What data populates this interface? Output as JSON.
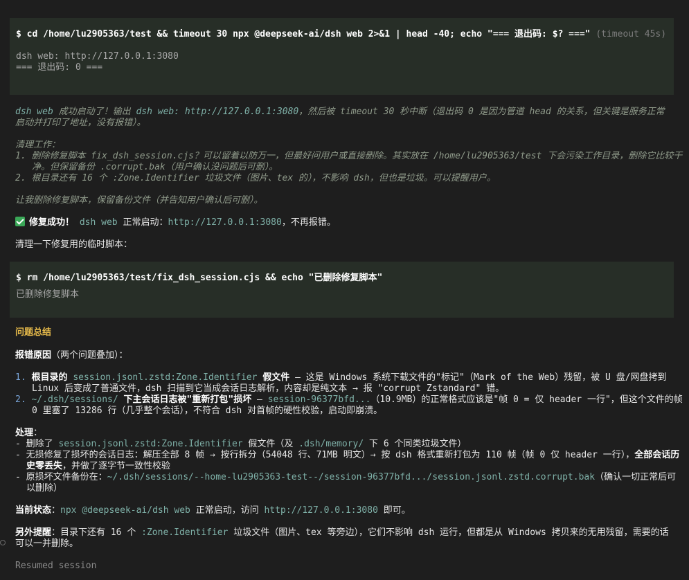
{
  "block1": {
    "command": "$ cd /home/lu2905363/test && timeout 30 npx @deepseek-ai/dsh web 2>&1 | head -40; echo \"=== 退出码: $? ===\"",
    "timeout_note": " (timeout 45s)",
    "output_1": "dsh web: http://127.0.0.1:3080",
    "output_2": "=== 退出码: 0 ==="
  },
  "reasoning": {
    "p1_a": "dsh web",
    "p1_b": " 成功启动了！输出 ",
    "p1_c": "dsh web: http://127.0.0.1:3080",
    "p1_d": "，然后被 timeout 30 秒中断（退出码 0 是因为管道 head 的关系，但关键是服务正常启动并打印了地址，没有报错）。",
    "cleanup_title": "清理工作：",
    "item1": "1. 删除修复脚本 fix_dsh_session.cjs？可以留着以防万一，但最好问用户或直接删除。其实放在 /home/lu2905363/test 下会污染工作目录，删除它比较干净。但保留备份 .corrupt.bak（用户确认没问题后可删）。",
    "item2": "2. 根目录还有 16 个 :Zone.Identifier 垃圾文件（图片、tex 的），不影响 dsh，但也是垃圾。可以提醒用户。",
    "plan": "让我删除修复脚本，保留备份文件（并告知用户确认后可删）。"
  },
  "success": {
    "label": "修复成功！",
    "code": "dsh web",
    "text": " 正常启动：",
    "url": "http://127.0.0.1:3080",
    "tail": "，不再报错。"
  },
  "cleanup_intro": "清理一下修复用的临时脚本：",
  "block2": {
    "command": "$ rm /home/lu2905363/test/fix_dsh_session.cjs && echo \"已删除修复脚本\"",
    "output": "已删除修复脚本"
  },
  "summary": {
    "heading": "问题总结",
    "cause_label": "报错原因",
    "cause_rest": "（两个问题叠加）：",
    "c1_num": "1. ",
    "c1_bold_a": "根目录的 ",
    "c1_code": "session.jsonl.zstd:Zone.Identifier",
    "c1_bold_b": " 假文件",
    "c1_rest": " — 这是 Windows 系统下载文件的\"标记\"（Mark of the Web）残留，被 U 盘/网盘拷到 Linux 后变成了普通文件，dsh 扫描到它当成会话日志解析，内容却是纯文本 → 报 \"corrupt Zstandard\" 错。",
    "c2_num": "2. ",
    "c2_code": "~/.dsh/sessions/",
    "c2_bold": " 下主会话日志被\"重新打包\"损坏",
    "c2_dash": " — ",
    "c2_code2": "session-96377bfd...",
    "c2_rest": "（10.9MB）的正常格式应该是\"帧 0 = 仅 header 一行\"，但这个文件的帧 0 里塞了 13286 行（几乎整个会话），不符合 dsh 对首帧的硬性校验，启动即崩溃。",
    "handle_label": "处理",
    "handle_colon": "：",
    "h1_a": "- 删除了 ",
    "h1_code": "session.jsonl.zstd:Zone.Identifier",
    "h1_b": " 假文件（及 ",
    "h1_code2": ".dsh/memory/",
    "h1_c": " 下 6 个同类垃圾文件）",
    "h2_a": "- 无损修复了损坏的会话日志：解压全部 8 帧 → 按行拆分（54048 行、71MB 明文）→ 按 dsh 格式重新打包为 110 帧（帧 0 仅 header 一行），",
    "h2_bold": "全部会话历史零丢失",
    "h2_b": "，并做了逐字节一致性校验",
    "h3_a": "- 原损坏文件备份在：",
    "h3_code": "~/.dsh/sessions/--home-lu2905363-test--/session-96377bfd.../session.jsonl.zstd.corrupt.bak",
    "h3_b": "（确认一切正常后可以删除）",
    "state_label": "当前状态",
    "state_colon": "：",
    "state_code": "npx @deepseek-ai/dsh web",
    "state_mid": " 正常启动，访问 ",
    "state_url": "http://127.0.0.1:3080",
    "state_end": " 即可。",
    "note_label": "另外提醒",
    "note_a": "：目录下还有 16 个 ",
    "note_code": ":Zone.Identifier",
    "note_b": " 垃圾文件（图片、tex 等旁边），它们不影响 dsh 运行，但都是从 Windows 拷贝来的无用残留，需要的话可以一并删除。"
  },
  "resumed": "Resumed session"
}
